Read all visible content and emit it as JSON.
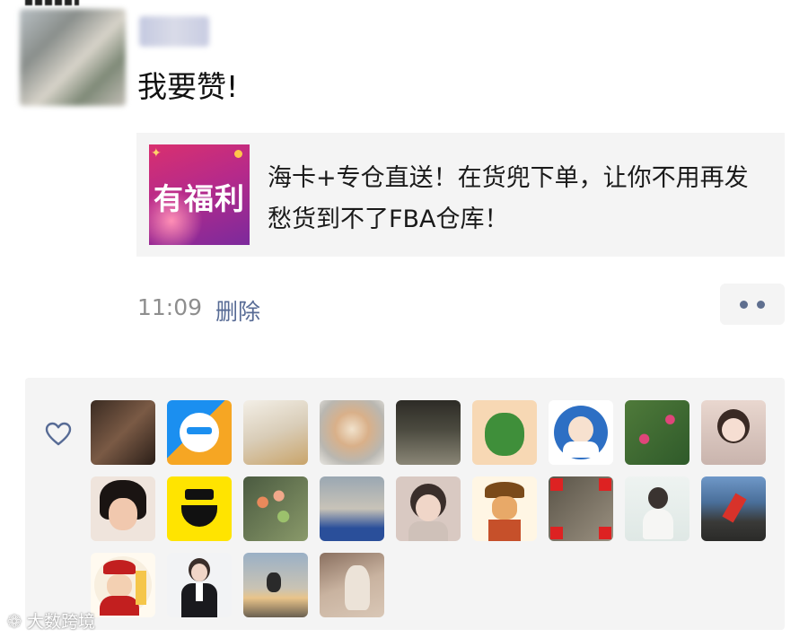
{
  "post": {
    "text": "我要赞!"
  },
  "link_card": {
    "thumb_label": "有福利",
    "text": "海卡+专仓直送！在货兜下单，让你不用再发愁货到不了FBA仓库！"
  },
  "meta": {
    "time": "11:09",
    "delete_label": "删除"
  },
  "likes": {
    "count": 21
  },
  "watermark": "大数跨境",
  "colors": {
    "link_blue": "#576b95",
    "card_bg": "#f4f4f4",
    "time_gray": "#8e8e8e"
  }
}
